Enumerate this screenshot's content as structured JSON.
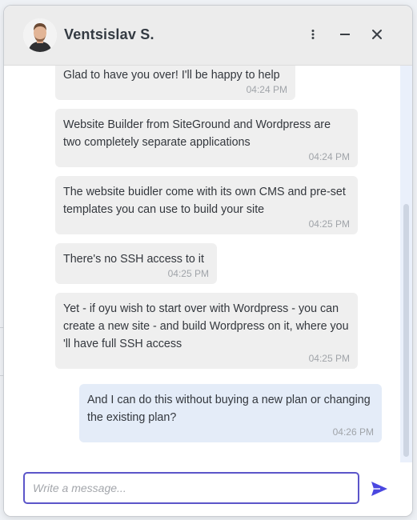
{
  "header": {
    "agent_name": "Ventsislav S.",
    "more_icon": "more-vertical-icon",
    "minimize_icon": "minimize-icon",
    "close_icon": "close-icon"
  },
  "messages": [
    {
      "sender": "agent",
      "text": "Glad to have you over! I'll be happy to help",
      "time": "04:24 PM"
    },
    {
      "sender": "agent",
      "text": "Website Builder from SiteGround and Wordpress are two completely separate applications",
      "time": "04:24 PM"
    },
    {
      "sender": "agent",
      "text": "The website buidler come with its own CMS and pre-set templates you can use to build your site",
      "time": "04:25 PM"
    },
    {
      "sender": "agent",
      "text": "There's no SSH access to it",
      "time": "04:25 PM"
    },
    {
      "sender": "agent",
      "text": "Yet - if oyu wish to start over with Wordpress - you can create a new site - and build Wordpress on it, where you 'll have full SSH access",
      "time": "04:25 PM"
    },
    {
      "sender": "user",
      "text": "And I can do this without buying a new plan or changing the existing plan?",
      "time": "04:26 PM"
    }
  ],
  "composer": {
    "placeholder": "Write a message...",
    "value": "",
    "send_icon": "send-icon"
  },
  "colors": {
    "accent": "#5b55c9",
    "send": "#4a47e0",
    "agent_bubble": "#efefef",
    "user_bubble": "#e4ecf8",
    "header_bg": "#ececec"
  }
}
